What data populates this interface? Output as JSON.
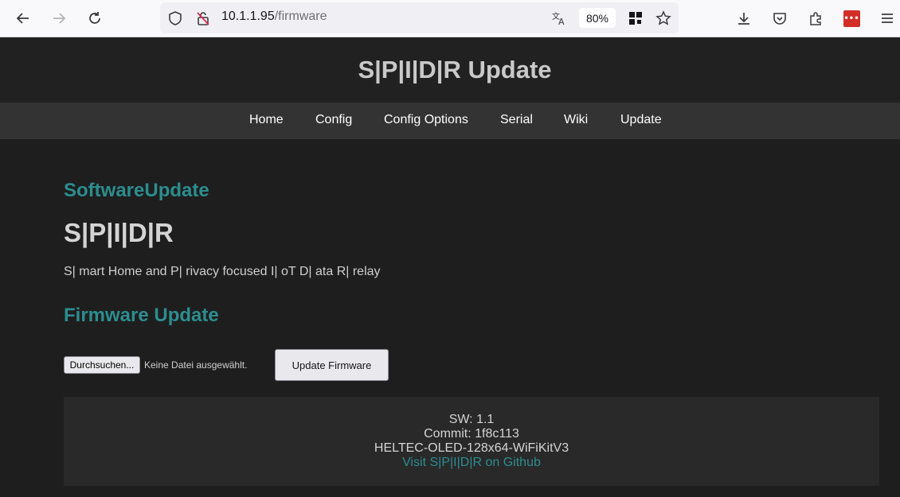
{
  "browser": {
    "url_host": "10.1.1.95",
    "url_path": "/firmware",
    "zoom": "80%",
    "extension_badge": "•••"
  },
  "page": {
    "title": "S|P|I|D|R Update",
    "nav": [
      "Home",
      "Config",
      "Config Options",
      "Serial",
      "Wiki",
      "Update"
    ],
    "software_update_heading": "SoftwareUpdate",
    "product_name": "S|P|I|D|R",
    "tagline": "S| mart Home and P| rivacy focused I| oT D| ata R| relay",
    "firmware_heading": "Firmware Update",
    "file_button": "Durchsuchen...",
    "file_status": "Keine Datei ausgewählt.",
    "submit_button": "Update Firmware"
  },
  "footer": {
    "sw": "SW: 1.1",
    "commit": "Commit: 1f8c113",
    "board": "HELTEC-OLED-128x64-WiFiKitV3",
    "github_link": "Visit S|P|I|D|R on Github"
  },
  "colors": {
    "page_bg": "#1e1e1e",
    "nav_bg": "#333333",
    "accent": "#2c8d8f",
    "heading_text": "#c9c9c9"
  }
}
